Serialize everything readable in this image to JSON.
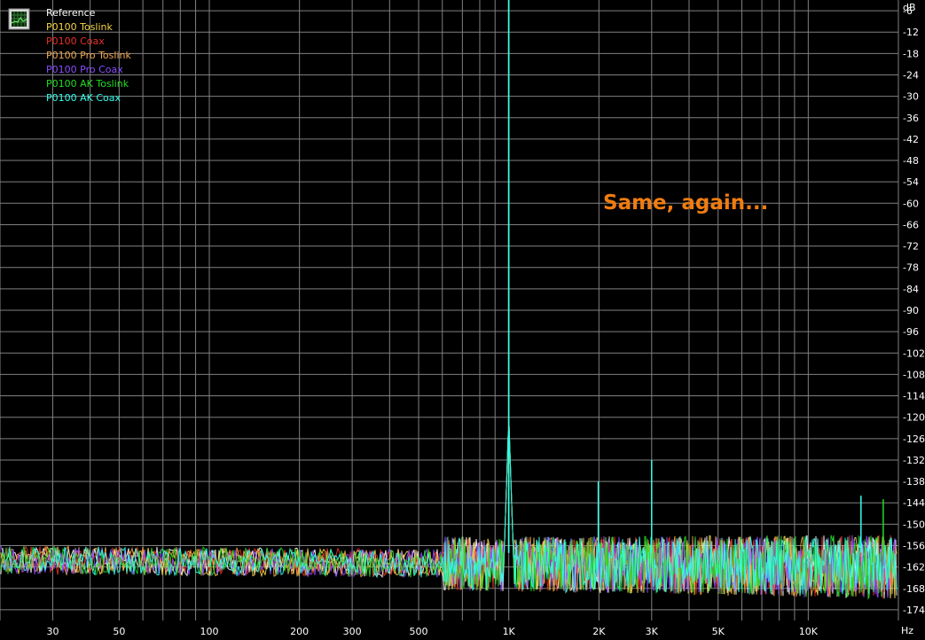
{
  "chart_data": {
    "type": "line",
    "title": "",
    "xlabel": "Hz",
    "ylabel": "dB",
    "xscale": "log",
    "xlim": [
      20,
      20000
    ],
    "ylim": [
      -177,
      -3
    ],
    "grid": true,
    "legend_position": "top-left",
    "x_ticks": [
      {
        "value": 30,
        "label": "30"
      },
      {
        "value": 50,
        "label": "50"
      },
      {
        "value": 100,
        "label": "100"
      },
      {
        "value": 200,
        "label": "200"
      },
      {
        "value": 300,
        "label": "300"
      },
      {
        "value": 500,
        "label": "500"
      },
      {
        "value": 1000,
        "label": "1K"
      },
      {
        "value": 2000,
        "label": "2K"
      },
      {
        "value": 3000,
        "label": "3K"
      },
      {
        "value": 5000,
        "label": "5K"
      },
      {
        "value": 10000,
        "label": "10K"
      }
    ],
    "y_ticks": [
      -6,
      -12,
      -18,
      -24,
      -30,
      -36,
      -42,
      -48,
      -54,
      -60,
      -66,
      -72,
      -78,
      -84,
      -90,
      -96,
      -102,
      -108,
      -114,
      -120,
      -126,
      -132,
      -138,
      -144,
      -150,
      -156,
      -162,
      -168,
      -174
    ],
    "annotation": {
      "text": "Same, again...",
      "color": "#f07c10"
    },
    "series": [
      {
        "name": "Reference",
        "color": "#ffffff",
        "noise_floor_db": -160,
        "peaks": [
          {
            "x": 1000,
            "y": -3
          }
        ]
      },
      {
        "name": "P0100 Toslink",
        "color": "#f5d547",
        "noise_floor_db": -160,
        "peaks": [
          {
            "x": 1000,
            "y": -3
          }
        ]
      },
      {
        "name": "P0100 Coax",
        "color": "#e8302a",
        "noise_floor_db": -160,
        "peaks": [
          {
            "x": 1000,
            "y": -3
          }
        ]
      },
      {
        "name": "P0100 Pro Toslink",
        "color": "#f0a850",
        "noise_floor_db": -160,
        "peaks": [
          {
            "x": 1000,
            "y": -3
          }
        ]
      },
      {
        "name": "P0100 Pro Coax",
        "color": "#8a4dff",
        "noise_floor_db": -160,
        "peaks": [
          {
            "x": 1000,
            "y": -3
          }
        ]
      },
      {
        "name": "P0100 AK Toslink",
        "color": "#22dd22",
        "noise_floor_db": -160,
        "peaks": [
          {
            "x": 1000,
            "y": -3
          },
          {
            "x": 17800,
            "y": -143
          }
        ]
      },
      {
        "name": "P0100 AK Coax",
        "color": "#33ffee",
        "noise_floor_db": -160,
        "peaks": [
          {
            "x": 1000,
            "y": -3
          },
          {
            "x": 1990,
            "y": -138
          },
          {
            "x": 3000,
            "y": -132
          },
          {
            "x": 15000,
            "y": -142
          }
        ]
      }
    ]
  }
}
